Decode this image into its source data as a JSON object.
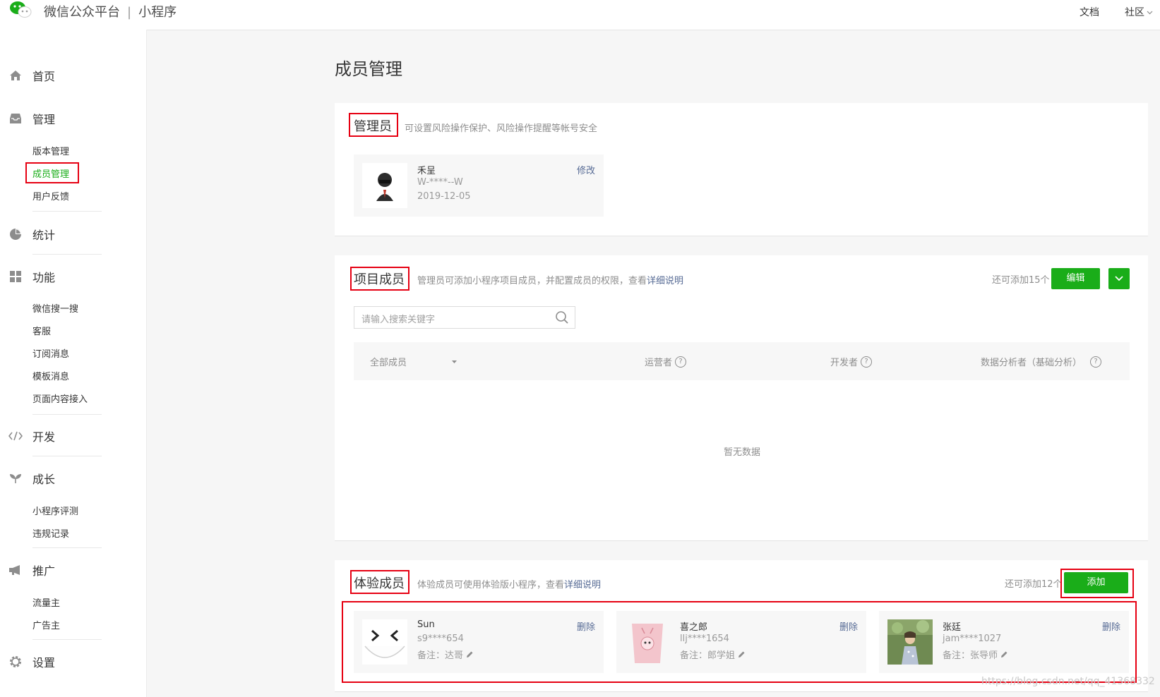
{
  "header": {
    "platform": "微信公众平台",
    "separator": "|",
    "product": "小程序",
    "docs_link": "文档",
    "community_link": "社区"
  },
  "sidebar": {
    "home": "首页",
    "manage": "管理",
    "manage_items": [
      "版本管理",
      "成员管理",
      "用户反馈"
    ],
    "stats": "统计",
    "features": "功能",
    "feature_items": [
      "微信搜一搜",
      "客服",
      "订阅消息",
      "模板消息",
      "页面内容接入"
    ],
    "dev": "开发",
    "growth": "成长",
    "growth_items": [
      "小程序评测",
      "违规记录"
    ],
    "promotion": "推广",
    "promotion_items": [
      "流量主",
      "广告主"
    ],
    "settings": "设置"
  },
  "page": {
    "title": "成员管理"
  },
  "admin": {
    "title": "管理员",
    "desc": "可设置风险操作保护、风险操作提醒等帐号安全",
    "member": {
      "name": "禾呈",
      "id": "W-****--W",
      "date": "2019-12-05",
      "action": "修改"
    }
  },
  "project": {
    "title": "项目成员",
    "desc": "管理员可添加小程序项目成员，并配置成员的权限，查看",
    "desc_link": "详细说明",
    "quota": "还可添加15个",
    "edit_button": "编辑",
    "search_placeholder": "请输入搜索关键字",
    "columns": [
      "全部成员",
      "运营者",
      "开发者",
      "数据分析者（基础分析）"
    ],
    "empty": "暂无数据"
  },
  "trial": {
    "title": "体验成员",
    "desc": "体验成员可使用体验版小程序，查看",
    "desc_link": "详细说明",
    "quota": "还可添加12个",
    "add_button": "添加",
    "members": [
      {
        "name": "Sun",
        "id": "s9****654",
        "note": "备注：达哥",
        "action": "删除"
      },
      {
        "name": "喜之郎",
        "id": "llj****1654",
        "note": "备注：郎学姐",
        "action": "删除"
      },
      {
        "name": "张廷",
        "id": "jam****1027",
        "note": "备注：张导师",
        "action": "删除"
      }
    ]
  },
  "watermark": "https://blog.csdn.net/qq_41368332",
  "colors": {
    "accent": "#1aad19",
    "link": "#576b95",
    "highlight": "#e60012"
  }
}
